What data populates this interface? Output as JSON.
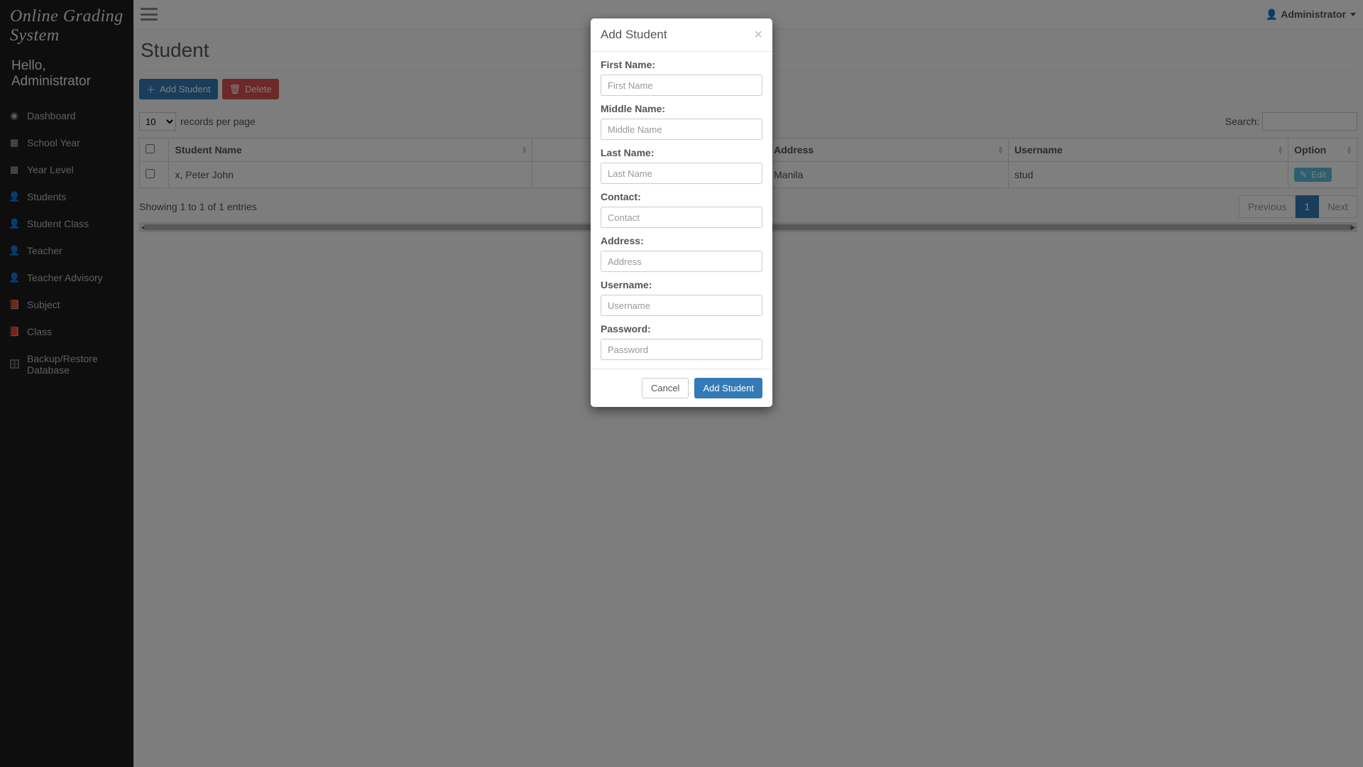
{
  "brand": "Online Grading System",
  "greeting": "Hello, Administrator",
  "sidebar": {
    "items": [
      {
        "icon": "◉",
        "label": "Dashboard"
      },
      {
        "icon": "▦",
        "label": "School Year"
      },
      {
        "icon": "▦",
        "label": "Year Level"
      },
      {
        "icon": "👤",
        "label": "Students"
      },
      {
        "icon": "👤",
        "label": "Student Class"
      },
      {
        "icon": "👤",
        "label": "Teacher"
      },
      {
        "icon": "👤",
        "label": "Teacher Advisory"
      },
      {
        "icon": "📕",
        "label": "Subject"
      },
      {
        "icon": "📕",
        "label": "Class"
      },
      {
        "icon": "🗄",
        "label": "Backup/Restore Database"
      }
    ]
  },
  "user": {
    "icon": "👤",
    "name": "Administrator"
  },
  "page": {
    "title": "Student",
    "toolbar": {
      "add": "Add Student",
      "delete": "Delete"
    },
    "per_page_value": "10",
    "per_page_label": "records per page",
    "search_label": "Search:",
    "columns": {
      "c1": "Student Name",
      "c4": "Address",
      "c5": "Username",
      "c6": "Option"
    },
    "row": {
      "name": "x, Peter John",
      "address": "Manila",
      "username": "stud",
      "edit": "Edit"
    },
    "entries_info": "Showing 1 to 1 of 1 entries",
    "pager": {
      "prev": "Previous",
      "page1": "1",
      "next": "Next"
    }
  },
  "modal": {
    "title": "Add Student",
    "fields": {
      "first_name": {
        "label": "First Name:",
        "ph": "First Name"
      },
      "middle_name": {
        "label": "Middle Name:",
        "ph": "Middle Name"
      },
      "last_name": {
        "label": "Last Name:",
        "ph": "Last Name"
      },
      "contact": {
        "label": "Contact:",
        "ph": "Contact"
      },
      "address": {
        "label": "Address:",
        "ph": "Address"
      },
      "username": {
        "label": "Username:",
        "ph": "Username"
      },
      "password": {
        "label": "Password:",
        "ph": "Password"
      }
    },
    "cancel": "Cancel",
    "submit": "Add Student"
  }
}
